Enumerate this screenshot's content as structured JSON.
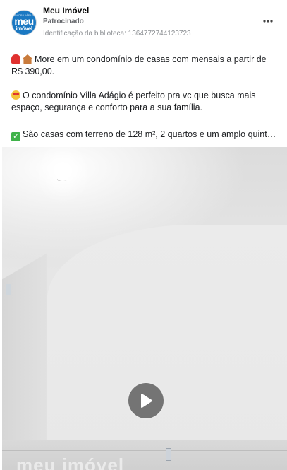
{
  "ad": {
    "page_name": "Meu Imóvel",
    "sponsored_label": "Patrocinado",
    "library_id": "Identificação da biblioteca: 1364772744123723",
    "avatar": {
      "small_text": "IMOBILIÁRIA",
      "main_text": "meu",
      "sub_text": "imóvel",
      "color": "#1a78c2"
    },
    "more_icon": "ellipsis-icon",
    "text_lines": [
      "More em um condomínio de casas com mensais a partir de R$ 390,00.",
      "O condomínio Villa Adágio é perfeito pra vc que busca mais espaço, segurança e conforto para a sua família.",
      "São casas com terreno de 128 m², 2 quartos e um amplo quint…"
    ],
    "video": {
      "play_icon": "play-icon",
      "watermark": "meu imóvel"
    }
  }
}
